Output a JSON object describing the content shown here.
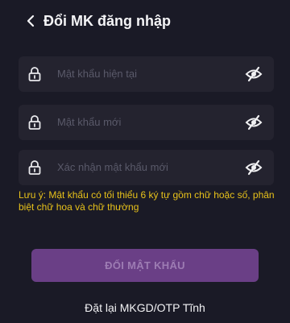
{
  "header": {
    "title": "Đổi MK đăng nhập"
  },
  "fields": [
    {
      "placeholder": "Mật khẩu hiện tại"
    },
    {
      "placeholder": "Mật khẩu mới"
    },
    {
      "placeholder": "Xác nhận mật khẩu mới"
    }
  ],
  "note": "Lưu ý: Mật khẩu có tối thiểu 6 ký tự gồm chữ hoặc số, phân biệt chữ hoa và chữ thường",
  "submit_label": "ĐỔI MẬT KHẨU",
  "reset_link": "Đặt lại MKGD/OTP Tĩnh",
  "colors": {
    "background": "#1a1a26",
    "field": "#24232f",
    "note": "#e8c21a",
    "button": "#6a3f86"
  }
}
